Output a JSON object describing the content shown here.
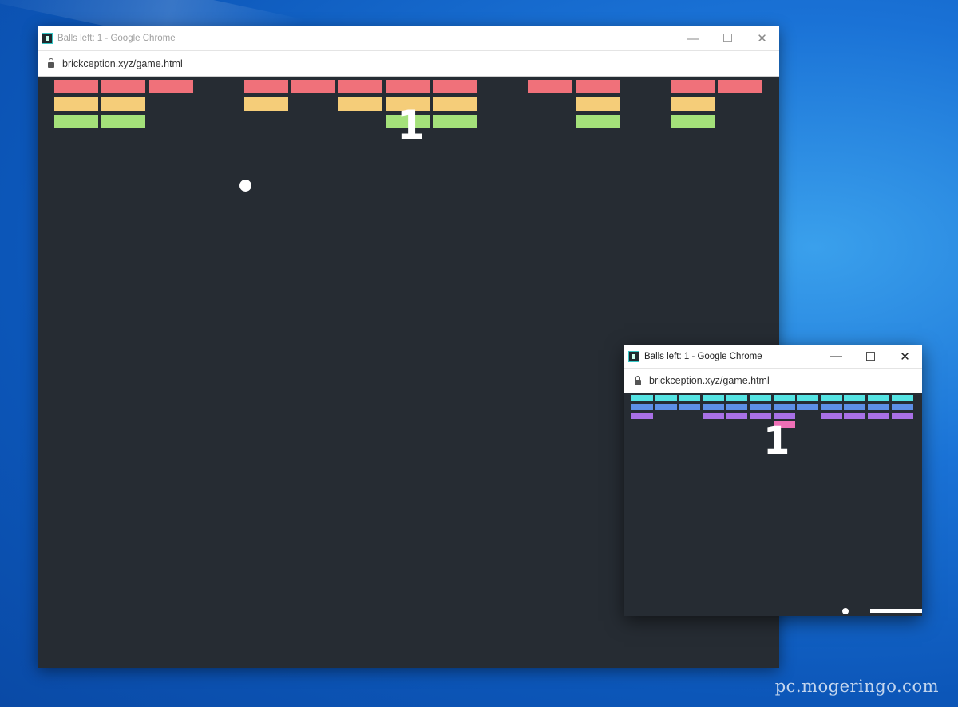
{
  "window_large": {
    "title": "Balls left: 1 - Google Chrome",
    "url": "brickception.xyz/game.html",
    "minimize_glyph": "—",
    "maximize_glyph": "☐",
    "close_glyph": "✕",
    "score": "1",
    "brick_colors": [
      "#f0717a",
      "#f5cd79",
      "#a4e17a"
    ],
    "bricks": [
      [
        1,
        1,
        1,
        0,
        1,
        1,
        1,
        1,
        1,
        0,
        1,
        1,
        0,
        1,
        1
      ],
      [
        1,
        1,
        0,
        0,
        1,
        0,
        1,
        1,
        1,
        0,
        0,
        1,
        0,
        1,
        0
      ],
      [
        1,
        1,
        0,
        0,
        0,
        0,
        0,
        1,
        1,
        0,
        0,
        1,
        0,
        1,
        0
      ]
    ]
  },
  "window_small": {
    "title": "Balls left: 1 - Google Chrome",
    "url": "brickception.xyz/game.html",
    "minimize_glyph": "—",
    "maximize_glyph": "☐",
    "close_glyph": "✕",
    "score": "1",
    "brick_colors": [
      "#54e3e3",
      "#5d8fe6",
      "#a870e6",
      "#ef6fb6"
    ],
    "bricks": [
      [
        1,
        1,
        1,
        1,
        1,
        1,
        1,
        1,
        1,
        1,
        1,
        1
      ],
      [
        1,
        1,
        1,
        1,
        1,
        1,
        1,
        1,
        1,
        1,
        1,
        1
      ],
      [
        1,
        0,
        0,
        1,
        1,
        1,
        1,
        0,
        1,
        1,
        1,
        1
      ],
      [
        0,
        0,
        0,
        0,
        0,
        0,
        1,
        0,
        0,
        0,
        0,
        0
      ]
    ]
  },
  "watermark": "pc.mogeringo.com"
}
